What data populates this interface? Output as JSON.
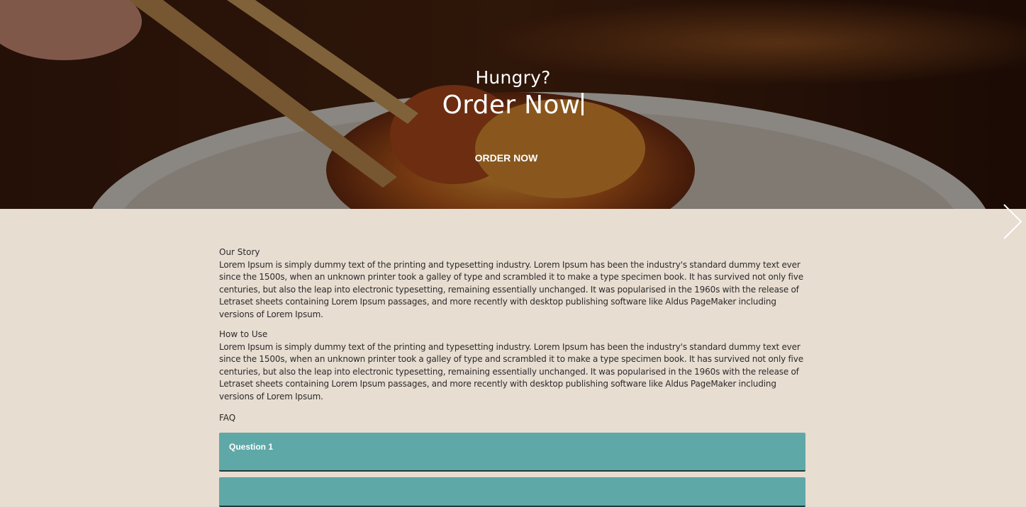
{
  "hero": {
    "subtitle": "Hungry?",
    "title": "Order Now",
    "cta_label": "ORDER NOW"
  },
  "sections": [
    {
      "title": "Our Story",
      "body": "Lorem Ipsum is simply dummy text of the printing and typesetting industry. Lorem Ipsum has been the industry's standard dummy text ever since the 1500s, when an unknown printer took a galley of type and scrambled it to make a type specimen book. It has survived not only five centuries, but also the leap into electronic typesetting, remaining essentially unchanged. It was popularised in the 1960s with the release of Letraset sheets containing Lorem Ipsum passages, and more recently with desktop publishing software like Aldus PageMaker including versions of Lorem Ipsum."
    },
    {
      "title": "How to Use",
      "body": "Lorem Ipsum is simply dummy text of the printing and typesetting industry. Lorem Ipsum has been the industry's standard dummy text ever since the 1500s, when an unknown printer took a galley of type and scrambled it to make a type specimen book. It has survived not only five centuries, but also the leap into electronic typesetting, remaining essentially unchanged. It was popularised in the 1960s with the release of Letraset sheets containing Lorem Ipsum passages, and more recently with desktop publishing software like Aldus PageMaker including versions of Lorem Ipsum."
    }
  ],
  "faq": {
    "title": "FAQ",
    "items": [
      {
        "question": "Question 1"
      },
      {
        "question": ""
      }
    ]
  },
  "icons": {
    "next": "chevron-right-icon"
  },
  "colors": {
    "background": "#e8ddd1",
    "faq_accent": "#5fa8a8",
    "hero_text": "#ffffff"
  }
}
